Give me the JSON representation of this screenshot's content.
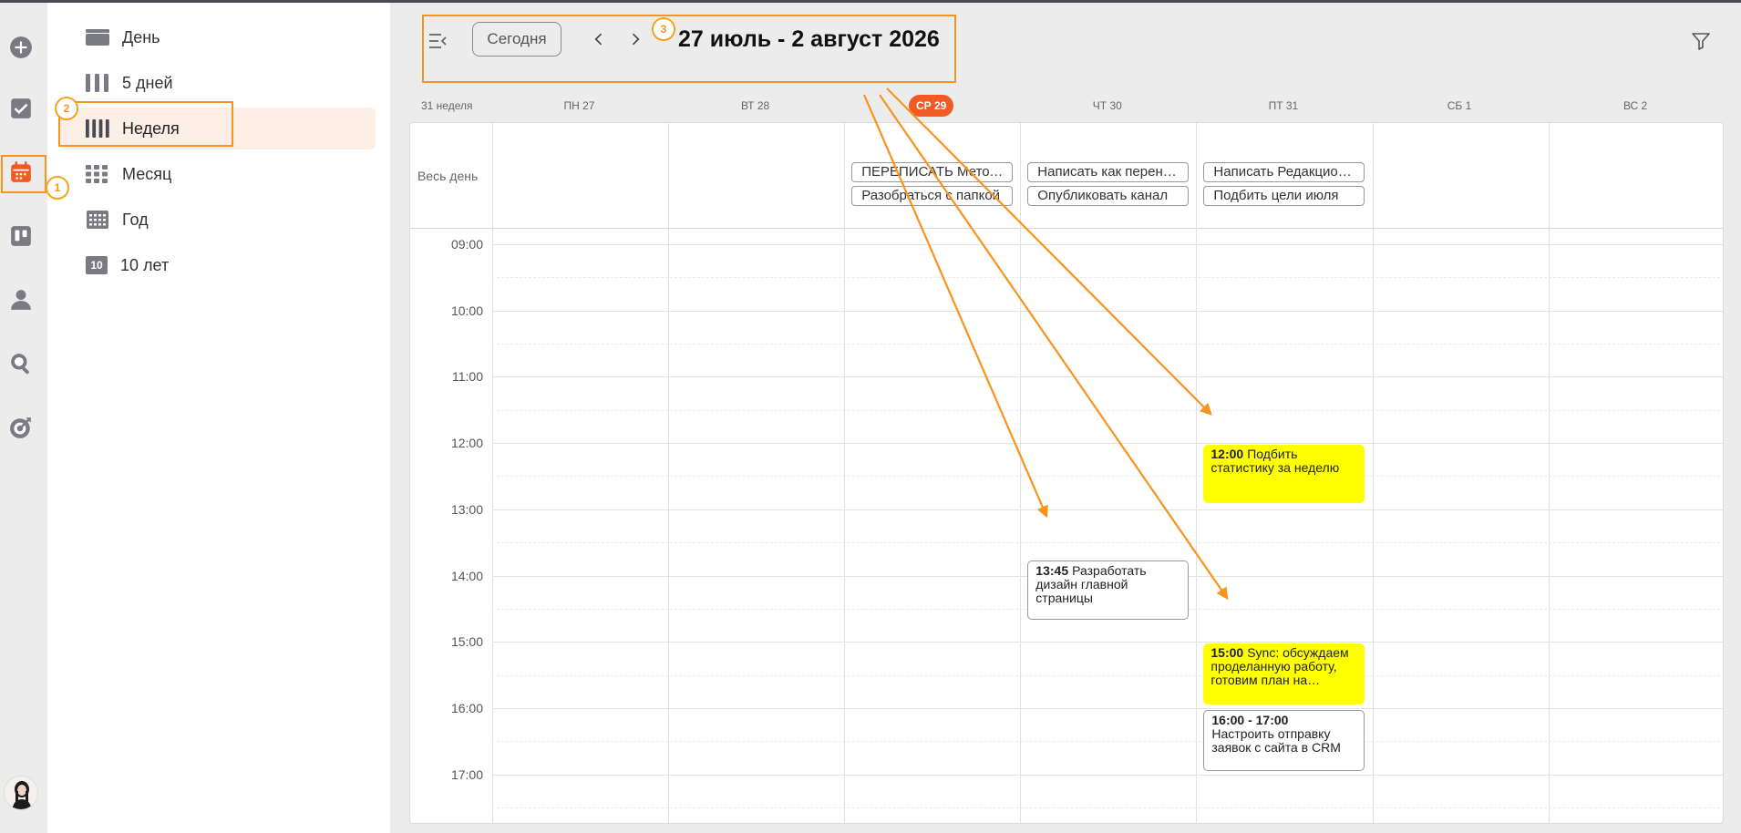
{
  "menu": {
    "items": [
      {
        "label": "День"
      },
      {
        "label": "5 дней"
      },
      {
        "label": "Неделя"
      },
      {
        "label": "Месяц"
      },
      {
        "label": "Год"
      },
      {
        "label": "10 лет",
        "badge": "10"
      }
    ]
  },
  "header": {
    "today_label": "Сегодня",
    "range_title": "27 июль - 2 август 2026"
  },
  "week": {
    "number_label": "31 неделя",
    "days": [
      "ПН 27",
      "ВТ 28",
      "СР 29",
      "ЧТ 30",
      "ПТ 31",
      "СБ 1",
      "ВС 2"
    ],
    "today_index": 2
  },
  "allday": {
    "label": "Весь день",
    "events": [
      {
        "day": 2,
        "row": 0,
        "text": "ПЕРЕПИСАТЬ Методичку"
      },
      {
        "day": 2,
        "row": 1,
        "text": "Разобраться с папкой"
      },
      {
        "day": 3,
        "row": 0,
        "text": "Написать как перенести"
      },
      {
        "day": 3,
        "row": 1,
        "text": "Опубликовать канал"
      },
      {
        "day": 4,
        "row": 0,
        "text": "Написать Редакционную политику"
      },
      {
        "day": 4,
        "row": 1,
        "text": "Подбить цели июля"
      }
    ]
  },
  "hours": [
    "09:00",
    "10:00",
    "11:00",
    "12:00",
    "13:00",
    "14:00",
    "15:00",
    "16:00",
    "17:00"
  ],
  "events": [
    {
      "day": 4,
      "start": 12.0,
      "end": 12.9,
      "time": "12:00",
      "title": "Подбить статистику за неделю",
      "style": "yellow"
    },
    {
      "day": 3,
      "start": 13.75,
      "end": 14.67,
      "time": "13:45",
      "title": "Разработать дизайн главной страницы",
      "style": "outline"
    },
    {
      "day": 4,
      "start": 15.0,
      "end": 15.95,
      "time": "15:00",
      "title": "Sync: обсуждаем проделанную работу, готовим план на…",
      "style": "yellow"
    },
    {
      "day": 4,
      "start": 16.0,
      "end": 16.95,
      "time": "16:00 - 17:00",
      "title": "Настроить отправку заявок с сайта в CRM",
      "style": "outline"
    }
  ],
  "annotations": [
    "1",
    "2",
    "3"
  ],
  "colors": {
    "accent": "#f15a24",
    "annotation": "#f7941d",
    "event_yellow": "#ffff00",
    "rail_icon": "#7a7a85"
  }
}
